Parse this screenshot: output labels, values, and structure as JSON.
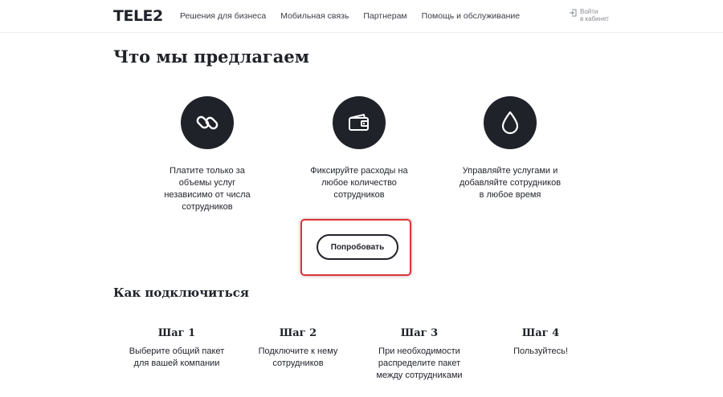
{
  "header": {
    "logo": "TELE2",
    "nav": [
      "Решения для бизнеса",
      "Мобильная связь",
      "Партнерам",
      "Помощь и обслуживание"
    ],
    "login_line1": "Войти",
    "login_line2": "в кабинет"
  },
  "main": {
    "title": "Что мы предлагаем",
    "features": [
      {
        "icon": "chain-link-icon",
        "text": [
          "Платите только за",
          "объемы услуг",
          "независимо от числа",
          "сотрудников"
        ]
      },
      {
        "icon": "wallet-icon",
        "text": [
          "Фиксируйте расходы на",
          "любое количество",
          "сотрудников"
        ]
      },
      {
        "icon": "drop-icon",
        "text": [
          "Управляйте услугами и",
          "добавляйте сотрудников",
          "в любое время"
        ]
      }
    ],
    "try_button": "Попробовать",
    "how_title": "Как подключиться",
    "steps": [
      {
        "title": "Шаг 1",
        "text": [
          "Выберите общий пакет",
          "для вашей компании"
        ]
      },
      {
        "title": "Шаг 2",
        "text": [
          "Подключите к нему",
          "сотрудников"
        ]
      },
      {
        "title": "Шаг 3",
        "text": [
          "При необходимости",
          "распределите пакет",
          "между сотрудниками"
        ]
      },
      {
        "title": "Шаг 4",
        "text": [
          "Пользуйтесь!"
        ]
      }
    ]
  },
  "colors": {
    "dark": "#1f2229",
    "highlight": "#d9343a"
  }
}
